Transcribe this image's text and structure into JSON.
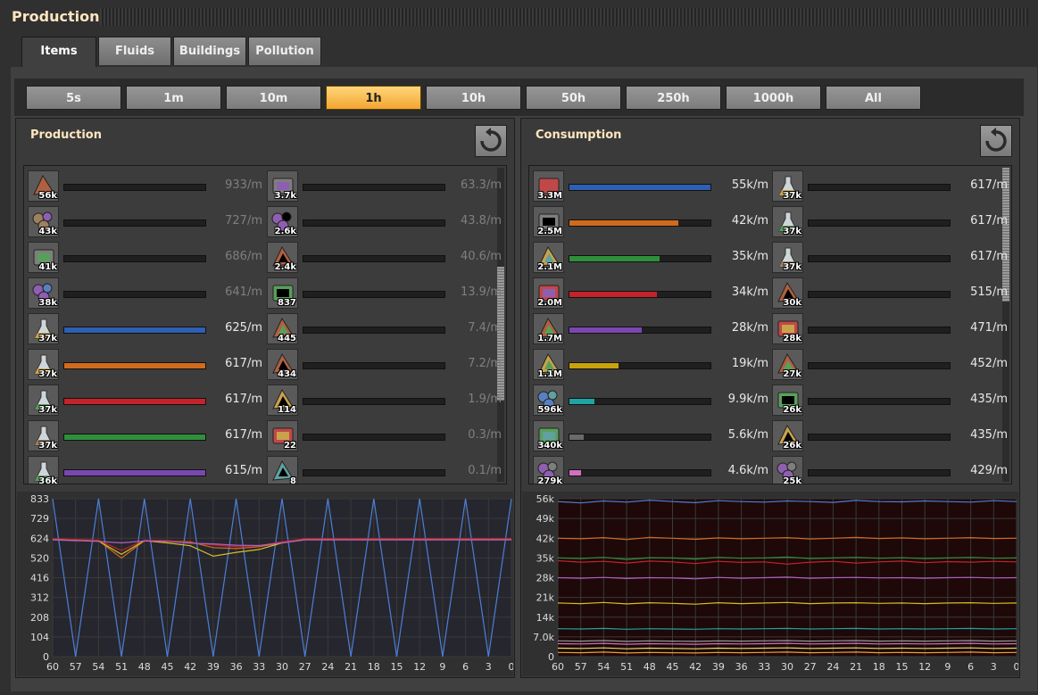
{
  "window": {
    "title": "Production"
  },
  "tabs": [
    {
      "label": "Items",
      "active": true
    },
    {
      "label": "Fluids",
      "active": false
    },
    {
      "label": "Buildings",
      "active": false
    },
    {
      "label": "Pollution",
      "active": false
    }
  ],
  "time_ranges": [
    {
      "label": "5s",
      "active": false
    },
    {
      "label": "1m",
      "active": false
    },
    {
      "label": "10m",
      "active": false
    },
    {
      "label": "1h",
      "active": true
    },
    {
      "label": "10h",
      "active": false
    },
    {
      "label": "50h",
      "active": false
    },
    {
      "label": "250h",
      "active": false
    },
    {
      "label": "1000h",
      "active": false
    },
    {
      "label": "All",
      "active": false
    }
  ],
  "colors": {
    "accent": "#f3a531",
    "title": "#ffe6c0"
  },
  "production": {
    "title": "Production",
    "reset_icon": "reset-icon",
    "scroll_fraction": 0.55,
    "columns": [
      [
        {
          "icon": "stone-icon",
          "count": "56k",
          "rate": "933/m",
          "fill": 0,
          "color": "",
          "dim": true
        },
        {
          "icon": "stone-furnace-icon",
          "count": "43k",
          "rate": "727/m",
          "fill": 0,
          "color": "",
          "dim": true
        },
        {
          "icon": "sulfur-icon",
          "count": "41k",
          "rate": "686/m",
          "fill": 0,
          "color": "",
          "dim": true
        },
        {
          "icon": "advanced-circuit-icon",
          "count": "38k",
          "rate": "641/m",
          "fill": 0,
          "color": "",
          "dim": true
        },
        {
          "icon": "automation-science-pack-icon",
          "count": "37k",
          "rate": "625/m",
          "fill": 1.0,
          "color": "#2d5fb3",
          "dim": false
        },
        {
          "icon": "chemical-science-pack-icon",
          "count": "37k",
          "rate": "617/m",
          "fill": 1.0,
          "color": "#d06b1e",
          "dim": false
        },
        {
          "icon": "production-science-pack-icon",
          "count": "37k",
          "rate": "617/m",
          "fill": 1.0,
          "color": "#c4232b",
          "dim": false
        },
        {
          "icon": "utility-science-pack-icon",
          "count": "37k",
          "rate": "617/m",
          "fill": 1.0,
          "color": "#2f8f3b",
          "dim": false
        },
        {
          "icon": "space-science-pack-icon",
          "count": "36k",
          "rate": "615/m",
          "fill": 1.0,
          "color": "#7a47b0",
          "dim": false
        }
      ],
      [
        {
          "icon": "engine-unit-icon",
          "count": "3.7k",
          "rate": "63.3/m",
          "fill": 0,
          "color": "",
          "dim": true
        },
        {
          "icon": "electric-engine-icon",
          "count": "2.6k",
          "rate": "43.8/m",
          "fill": 0,
          "color": "",
          "dim": true
        },
        {
          "icon": "solar-panel-icon",
          "count": "2.4k",
          "rate": "40.6/m",
          "fill": 0,
          "color": "",
          "dim": true
        },
        {
          "icon": "uranium-ore-icon",
          "count": "837",
          "rate": "13.9/m",
          "fill": 0,
          "color": "",
          "dim": true
        },
        {
          "icon": "barrel-icon",
          "count": "445",
          "rate": "7.4/m",
          "fill": 0,
          "color": "",
          "dim": true
        },
        {
          "icon": "uranium-235-icon",
          "count": "434",
          "rate": "7.2/m",
          "fill": 0,
          "color": "",
          "dim": true
        },
        {
          "icon": "robot-frame-icon",
          "count": "114",
          "rate": "1.9/m",
          "fill": 0,
          "color": "",
          "dim": true
        },
        {
          "icon": "inserter-icon",
          "count": "22",
          "rate": "0.3/m",
          "fill": 0,
          "color": "",
          "dim": true
        },
        {
          "icon": "uranium-238-icon",
          "count": "8",
          "rate": "0.1/m",
          "fill": 0,
          "color": "",
          "dim": true
        }
      ]
    ],
    "chart": {
      "y_ticks": [
        "833",
        "729",
        "624",
        "520",
        "416",
        "312",
        "208",
        "104",
        "0"
      ],
      "x_ticks": [
        "60",
        "57",
        "54",
        "51",
        "48",
        "45",
        "42",
        "39",
        "36",
        "33",
        "30",
        "27",
        "24",
        "21",
        "18",
        "15",
        "12",
        "9",
        "6",
        "3",
        "0"
      ]
    }
  },
  "consumption": {
    "title": "Consumption",
    "reset_icon": "reset-icon",
    "scroll_fraction": 0.0,
    "columns": [
      [
        {
          "icon": "copper-cable-icon",
          "count": "3.3M",
          "rate": "55k/m",
          "fill": 1.0,
          "color": "#2d5fb3",
          "dim": false
        },
        {
          "icon": "iron-plate-icon",
          "count": "2.5M",
          "rate": "42k/m",
          "fill": 0.77,
          "color": "#d06b1e",
          "dim": false
        },
        {
          "icon": "iron-ore-icon",
          "count": "2.1M",
          "rate": "35k/m",
          "fill": 0.64,
          "color": "#2f8f3b",
          "dim": false
        },
        {
          "icon": "copper-plate-icon",
          "count": "2.0M",
          "rate": "34k/m",
          "fill": 0.62,
          "color": "#c4232b",
          "dim": false
        },
        {
          "icon": "copper-ore-icon",
          "count": "1.7M",
          "rate": "28k/m",
          "fill": 0.51,
          "color": "#7a47b0",
          "dim": false
        },
        {
          "icon": "electronic-circuit-icon",
          "count": "1.1M",
          "rate": "19k/m",
          "fill": 0.35,
          "color": "#c9a20a",
          "dim": false
        },
        {
          "icon": "steel-plate-icon",
          "count": "596k",
          "rate": "9.9k/m",
          "fill": 0.18,
          "color": "#1fa3a3",
          "dim": false
        },
        {
          "icon": "iron-stick-icon",
          "count": "340k",
          "rate": "5.6k/m",
          "fill": 0.1,
          "color": "#6a6a6a",
          "dim": false
        },
        {
          "icon": "coal-icon",
          "count": "279k",
          "rate": "4.6k/m",
          "fill": 0.08,
          "color": "#d070c0",
          "dim": false
        }
      ],
      [
        {
          "icon": "chemical-science-pack-icon",
          "count": "37k",
          "rate": "617/m",
          "fill": 0,
          "color": "",
          "dim": false
        },
        {
          "icon": "production-science-pack-icon",
          "count": "37k",
          "rate": "617/m",
          "fill": 0,
          "color": "",
          "dim": false
        },
        {
          "icon": "utility-science-pack-icon",
          "count": "37k",
          "rate": "617/m",
          "fill": 0,
          "color": "",
          "dim": false
        },
        {
          "icon": "rail-icon",
          "count": "30k",
          "rate": "515/m",
          "fill": 0,
          "color": "",
          "dim": false
        },
        {
          "icon": "pipe-icon",
          "count": "28k",
          "rate": "471/m",
          "fill": 0,
          "color": "",
          "dim": false
        },
        {
          "icon": "processing-unit-icon",
          "count": "27k",
          "rate": "452/m",
          "fill": 0,
          "color": "",
          "dim": false
        },
        {
          "icon": "low-density-structure-icon",
          "count": "26k",
          "rate": "435/m",
          "fill": 0,
          "color": "",
          "dim": false
        },
        {
          "icon": "flying-robot-frame-icon",
          "count": "26k",
          "rate": "435/m",
          "fill": 0,
          "color": "",
          "dim": false
        },
        {
          "icon": "rocket-fuel-icon",
          "count": "25k",
          "rate": "429/m",
          "fill": 0,
          "color": "",
          "dim": false
        }
      ]
    ],
    "chart": {
      "y_ticks": [
        "56k",
        "49k",
        "42k",
        "35k",
        "28k",
        "21k",
        "14k",
        "7.0k",
        "0"
      ],
      "x_ticks": [
        "60",
        "57",
        "54",
        "51",
        "48",
        "45",
        "42",
        "39",
        "36",
        "33",
        "30",
        "27",
        "24",
        "21",
        "18",
        "15",
        "12",
        "9",
        "6",
        "3",
        "0"
      ]
    }
  },
  "chart_data": [
    {
      "type": "line",
      "ylim": [
        0,
        833
      ],
      "x_range": [
        60,
        0
      ],
      "grid": true,
      "series": [
        {
          "color": "#4b7fd6",
          "values": [
            833,
            0,
            833,
            0,
            833,
            0,
            833,
            0,
            833,
            0,
            833,
            0,
            833,
            0,
            833,
            0,
            833,
            0,
            833,
            0,
            833
          ]
        },
        {
          "color": "#d06b1e",
          "values": [
            620,
            615,
            612,
            520,
            612,
            610,
            605,
            575,
            570,
            580,
            600,
            620,
            620,
            620,
            620,
            620,
            620,
            620,
            620,
            620,
            620
          ]
        },
        {
          "color": "#d4c022",
          "values": [
            618,
            615,
            610,
            540,
            612,
            600,
            585,
            530,
            550,
            565,
            600,
            620,
            620,
            620,
            620,
            620,
            620,
            620,
            620,
            620,
            620
          ]
        },
        {
          "color": "#c4232b",
          "values": [
            622,
            618,
            614,
            560,
            614,
            612,
            600,
            590,
            580,
            585,
            605,
            622,
            622,
            622,
            622,
            622,
            622,
            622,
            622,
            622,
            622
          ]
        },
        {
          "color": "#b060c0",
          "values": [
            616,
            612,
            608,
            600,
            610,
            608,
            598,
            595,
            588,
            586,
            600,
            616,
            616,
            616,
            616,
            616,
            616,
            616,
            616,
            616,
            616
          ]
        }
      ]
    },
    {
      "type": "line",
      "ylim": [
        0,
        56000
      ],
      "x_range": [
        60,
        0
      ],
      "grid": true,
      "series": [
        {
          "color": "#4b7fd6",
          "values": [
            55000,
            54500,
            55200,
            54800,
            55500,
            55000,
            54600,
            55300,
            55000,
            54800,
            55200,
            55000,
            54700,
            55400,
            55000,
            54900,
            55200,
            55000,
            54800,
            55300,
            55000
          ]
        },
        {
          "color": "#d06b1e",
          "values": [
            42000,
            41800,
            42200,
            41500,
            42300,
            42000,
            41600,
            42100,
            41800,
            42000,
            42200,
            41700,
            42000,
            42300,
            41900,
            42100,
            41800,
            42000,
            42200,
            41900,
            42000
          ]
        },
        {
          "color": "#2f8f3b",
          "values": [
            35000,
            34800,
            35200,
            34500,
            35100,
            35000,
            34600,
            35200,
            34900,
            35000,
            35300,
            34800,
            35000,
            35200,
            34900,
            35100,
            34800,
            35000,
            35200,
            34900,
            35000
          ]
        },
        {
          "color": "#c4232b",
          "values": [
            34000,
            33500,
            33800,
            33200,
            33900,
            33600,
            33000,
            33800,
            33400,
            33600,
            32800,
            33500,
            33800,
            33200,
            33600,
            33900,
            33300,
            33700,
            33500,
            33800,
            33600
          ]
        },
        {
          "color": "#b060c0",
          "values": [
            28000,
            27800,
            28100,
            27700,
            28000,
            27900,
            27600,
            28100,
            27800,
            28000,
            28200,
            27800,
            28000,
            28100,
            27900,
            28000,
            27800,
            28000,
            28100,
            27900,
            28000
          ]
        },
        {
          "color": "#d4c022",
          "values": [
            19000,
            18800,
            19200,
            18700,
            19100,
            18900,
            18600,
            19100,
            18800,
            19000,
            19200,
            18800,
            19000,
            19100,
            18900,
            19000,
            18800,
            19000,
            19100,
            18900,
            19000
          ]
        },
        {
          "color": "#1fa3a3",
          "values": [
            9900,
            9800,
            10000,
            9700,
            9900,
            9800,
            9700,
            9900,
            9800,
            9900,
            10000,
            9800,
            9900,
            10000,
            9800,
            9900,
            9800,
            9900,
            10000,
            9800,
            9900
          ]
        },
        {
          "color": "#9a9a9a",
          "values": [
            5600,
            5500,
            5700,
            5400,
            5600,
            5500,
            5400,
            5600,
            5500,
            5600,
            5700,
            5500,
            5600,
            5700,
            5500,
            5600,
            5500,
            5600,
            5700,
            5500,
            5600
          ]
        },
        {
          "color": "#d070c0",
          "values": [
            4600,
            4500,
            4700,
            4400,
            4600,
            4500,
            4400,
            4600,
            4500,
            4600,
            4700,
            4500,
            4600,
            4700,
            4500,
            4600,
            4500,
            4600,
            4700,
            4500,
            4600
          ]
        },
        {
          "color": "#e0e060",
          "values": [
            3000,
            2900,
            3100,
            2800,
            3000,
            2900,
            2800,
            3000,
            2900,
            3000,
            3100,
            2900,
            3000,
            3100,
            2900,
            3000,
            2900,
            3000,
            3100,
            2900,
            3000
          ]
        },
        {
          "color": "#e8a040",
          "values": [
            1500,
            1400,
            1600,
            1300,
            1500,
            1400,
            1300,
            1500,
            1400,
            1500,
            1600,
            1400,
            1500,
            1600,
            1400,
            1500,
            1400,
            1500,
            1600,
            1400,
            1500
          ]
        }
      ]
    }
  ]
}
